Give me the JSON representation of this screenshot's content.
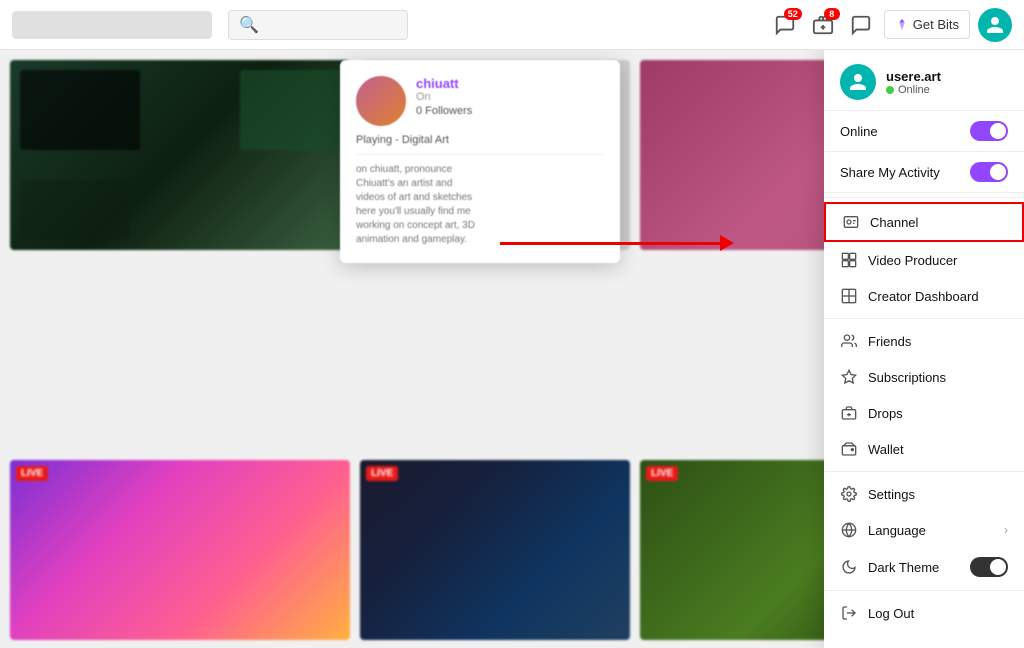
{
  "topnav": {
    "search_placeholder": "Search",
    "get_bits_label": "Get Bits",
    "notifications_badge": "52",
    "claims_badge": "8"
  },
  "profile_popup": {
    "username": "chiuatt",
    "status": "On",
    "followers": "0 Followers",
    "game_label": "Playing - Digital Art",
    "description": "on chiuatt, pronounce\nChiuatt's an artist and\nvideos of art and sketches\nhere you'll usually find me\nworking on concept art, 3D\nanimation and gameplay."
  },
  "dropdown": {
    "username": "usere.art",
    "online_label": "Online",
    "items": [
      {
        "id": "online",
        "label": "Online",
        "icon": "circle",
        "has_toggle": true,
        "toggle_on": true
      },
      {
        "id": "share-activity",
        "label": "Share My Activity",
        "icon": "share",
        "has_toggle": true,
        "toggle_on": true
      },
      {
        "id": "channel",
        "label": "Channel",
        "icon": "person-card",
        "highlighted": true
      },
      {
        "id": "video-producer",
        "label": "Video Producer",
        "icon": "video-grid"
      },
      {
        "id": "creator-dashboard",
        "label": "Creator Dashboard",
        "icon": "grid-square"
      },
      {
        "id": "friends",
        "label": "Friends",
        "icon": "friends"
      },
      {
        "id": "subscriptions",
        "label": "Subscriptions",
        "icon": "star"
      },
      {
        "id": "drops",
        "label": "Drops",
        "icon": "gift-card"
      },
      {
        "id": "wallet",
        "label": "Wallet",
        "icon": "wallet"
      },
      {
        "id": "settings",
        "label": "Settings",
        "icon": "gear"
      },
      {
        "id": "language",
        "label": "Language",
        "icon": "globe",
        "has_chevron": true
      },
      {
        "id": "dark-theme",
        "label": "Dark Theme",
        "icon": "moon",
        "has_dark_toggle": true
      },
      {
        "id": "logout",
        "label": "Log Out",
        "icon": "door-exit"
      }
    ],
    "divider_after": [
      "share-activity",
      "creator-dashboard",
      "wallet",
      "settings",
      "dark-theme"
    ]
  },
  "live_badges": [
    "LIVE",
    "LIVE",
    "LIVE"
  ],
  "tiles": [
    {
      "id": "tile-1"
    },
    {
      "id": "tile-2"
    },
    {
      "id": "tile-3"
    },
    {
      "id": "tile-4"
    },
    {
      "id": "tile-5"
    },
    {
      "id": "tile-6"
    }
  ]
}
